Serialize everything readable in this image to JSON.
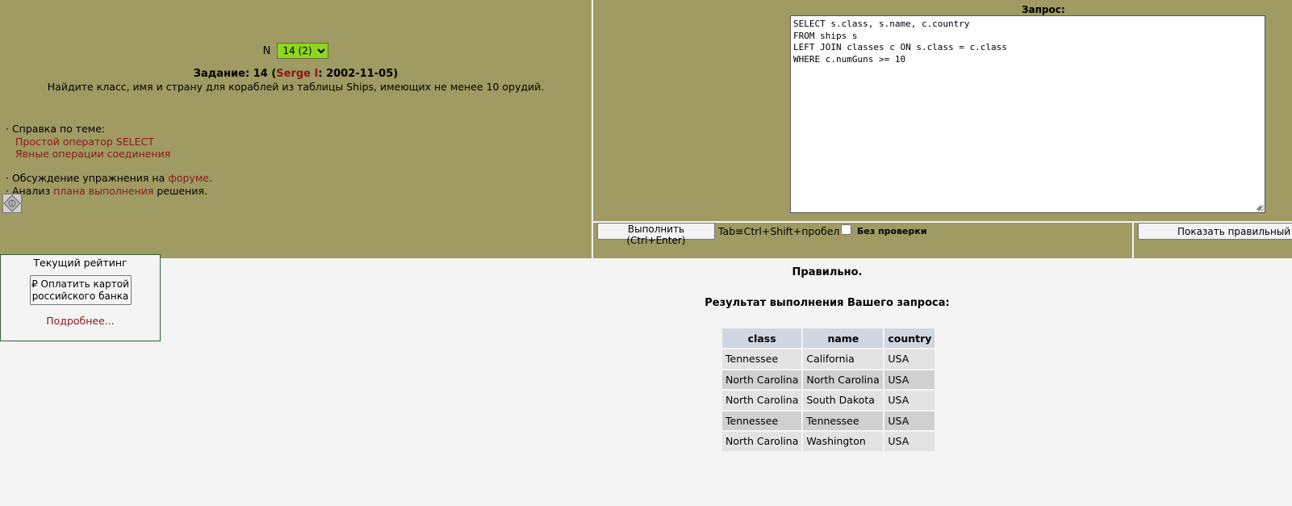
{
  "task": {
    "n_label": "N",
    "n_selected": "14 (2)",
    "title_prefix": "Задание: 14 (",
    "author": "Serge I",
    "title_suffix": ": 2002-11-05)",
    "description": "Найдите класс, имя и страну для кораблей из таблицы Ships, имеющих не менее 10 орудий."
  },
  "help": {
    "heading": "· Справка по теме:",
    "links": [
      "Простой оператор SELECT",
      "Явные операции соединения"
    ]
  },
  "discussion": {
    "prefix": "· Обсуждение упражнения на ",
    "link": "форуме",
    "suffix": "."
  },
  "plan": {
    "prefix": "· Анализ ",
    "link": "плана выполнения",
    "suffix": " решения."
  },
  "query": {
    "label": "Запрос:",
    "text": "SELECT s.class, s.name, c.country\nFROM ships s\nLEFT JOIN classes c ON s.class = c.class\nWHERE c.numGuns >= 10"
  },
  "controls": {
    "run_button": "Выполнить (Ctrl+Enter)",
    "tab_hint": "Tab≡Ctrl+Shift+пробел",
    "no_check": "Без проверки",
    "show_button": "Показать правильный"
  },
  "rating": {
    "title": "Текущий рейтинг",
    "pay_button": "₽ Оплатить картой российского банка",
    "more_link": "Подробнее..."
  },
  "result": {
    "status": "Правильно.",
    "title": "Результат выполнения Вашего запроса:",
    "columns": [
      "class",
      "name",
      "country"
    ],
    "rows": [
      [
        "Tennessee",
        "California",
        "USA"
      ],
      [
        "North Carolina",
        "North Carolina",
        "USA"
      ],
      [
        "North Carolina",
        "South Dakota",
        "USA"
      ],
      [
        "Tennessee",
        "Tennessee",
        "USA"
      ],
      [
        "North Carolina",
        "Washington",
        "USA"
      ]
    ]
  },
  "colors": {
    "panel": "#a09a63",
    "link": "#8b1a1a",
    "select_bg": "#8fd61f",
    "header_bg": "#d1d7e0"
  }
}
